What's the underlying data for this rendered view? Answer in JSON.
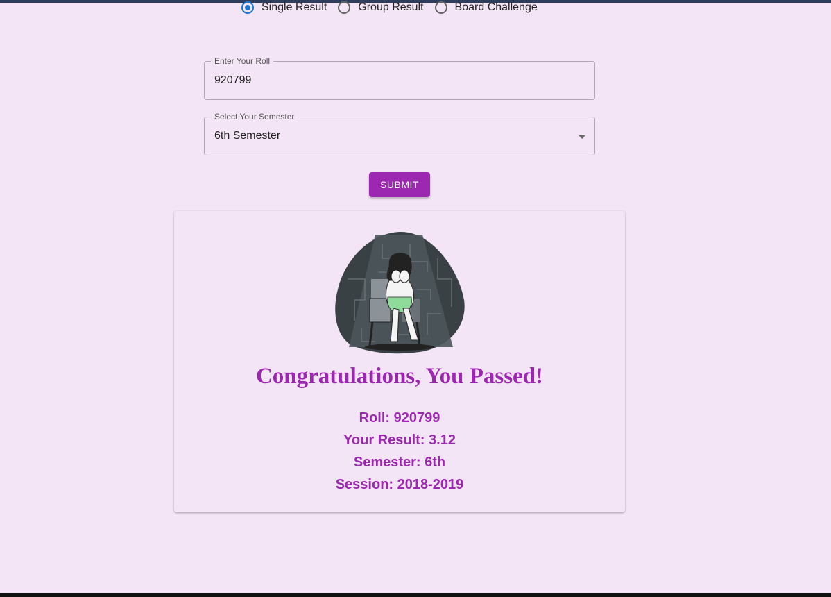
{
  "form": {
    "result_type_options": [
      {
        "label": "Single Result",
        "selected": true
      },
      {
        "label": "Group Result",
        "selected": false
      },
      {
        "label": "Board Challenge",
        "selected": false
      }
    ],
    "roll_field": {
      "label": "Enter Your Roll",
      "value": "920799"
    },
    "semester_field": {
      "label": "Select Your Semester",
      "value": "6th Semester"
    },
    "submit_label": "SUBMIT"
  },
  "result": {
    "illustration": "sad-girl-in-spotlight-illustration",
    "heading": "Congratulations, You Passed!",
    "roll": "Roll: 920799",
    "gpa": "Your Result: 3.12",
    "semester": "Semester: 6th",
    "session": "Session: 2018-2019"
  },
  "colors": {
    "background": "#f3e5f5",
    "accent": "#9c27b0",
    "radio_selected": "#1976d2"
  }
}
